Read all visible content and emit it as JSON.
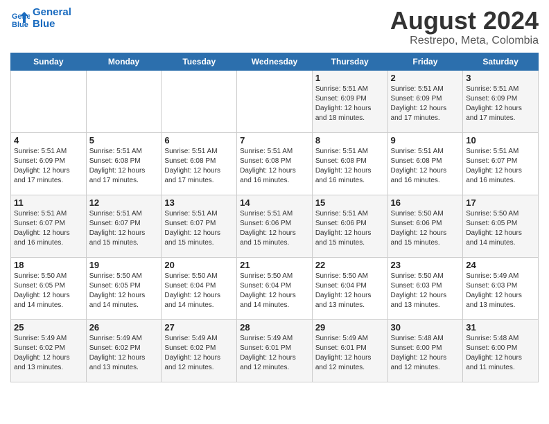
{
  "header": {
    "logo_line1": "General",
    "logo_line2": "Blue",
    "title": "August 2024",
    "subtitle": "Restrepo, Meta, Colombia"
  },
  "days_of_week": [
    "Sunday",
    "Monday",
    "Tuesday",
    "Wednesday",
    "Thursday",
    "Friday",
    "Saturday"
  ],
  "weeks": [
    [
      {
        "day": "",
        "info": ""
      },
      {
        "day": "",
        "info": ""
      },
      {
        "day": "",
        "info": ""
      },
      {
        "day": "",
        "info": ""
      },
      {
        "day": "1",
        "info": "Sunrise: 5:51 AM\nSunset: 6:09 PM\nDaylight: 12 hours\nand 18 minutes."
      },
      {
        "day": "2",
        "info": "Sunrise: 5:51 AM\nSunset: 6:09 PM\nDaylight: 12 hours\nand 17 minutes."
      },
      {
        "day": "3",
        "info": "Sunrise: 5:51 AM\nSunset: 6:09 PM\nDaylight: 12 hours\nand 17 minutes."
      }
    ],
    [
      {
        "day": "4",
        "info": "Sunrise: 5:51 AM\nSunset: 6:09 PM\nDaylight: 12 hours\nand 17 minutes."
      },
      {
        "day": "5",
        "info": "Sunrise: 5:51 AM\nSunset: 6:08 PM\nDaylight: 12 hours\nand 17 minutes."
      },
      {
        "day": "6",
        "info": "Sunrise: 5:51 AM\nSunset: 6:08 PM\nDaylight: 12 hours\nand 17 minutes."
      },
      {
        "day": "7",
        "info": "Sunrise: 5:51 AM\nSunset: 6:08 PM\nDaylight: 12 hours\nand 16 minutes."
      },
      {
        "day": "8",
        "info": "Sunrise: 5:51 AM\nSunset: 6:08 PM\nDaylight: 12 hours\nand 16 minutes."
      },
      {
        "day": "9",
        "info": "Sunrise: 5:51 AM\nSunset: 6:08 PM\nDaylight: 12 hours\nand 16 minutes."
      },
      {
        "day": "10",
        "info": "Sunrise: 5:51 AM\nSunset: 6:07 PM\nDaylight: 12 hours\nand 16 minutes."
      }
    ],
    [
      {
        "day": "11",
        "info": "Sunrise: 5:51 AM\nSunset: 6:07 PM\nDaylight: 12 hours\nand 16 minutes."
      },
      {
        "day": "12",
        "info": "Sunrise: 5:51 AM\nSunset: 6:07 PM\nDaylight: 12 hours\nand 15 minutes."
      },
      {
        "day": "13",
        "info": "Sunrise: 5:51 AM\nSunset: 6:07 PM\nDaylight: 12 hours\nand 15 minutes."
      },
      {
        "day": "14",
        "info": "Sunrise: 5:51 AM\nSunset: 6:06 PM\nDaylight: 12 hours\nand 15 minutes."
      },
      {
        "day": "15",
        "info": "Sunrise: 5:51 AM\nSunset: 6:06 PM\nDaylight: 12 hours\nand 15 minutes."
      },
      {
        "day": "16",
        "info": "Sunrise: 5:50 AM\nSunset: 6:06 PM\nDaylight: 12 hours\nand 15 minutes."
      },
      {
        "day": "17",
        "info": "Sunrise: 5:50 AM\nSunset: 6:05 PM\nDaylight: 12 hours\nand 14 minutes."
      }
    ],
    [
      {
        "day": "18",
        "info": "Sunrise: 5:50 AM\nSunset: 6:05 PM\nDaylight: 12 hours\nand 14 minutes."
      },
      {
        "day": "19",
        "info": "Sunrise: 5:50 AM\nSunset: 6:05 PM\nDaylight: 12 hours\nand 14 minutes."
      },
      {
        "day": "20",
        "info": "Sunrise: 5:50 AM\nSunset: 6:04 PM\nDaylight: 12 hours\nand 14 minutes."
      },
      {
        "day": "21",
        "info": "Sunrise: 5:50 AM\nSunset: 6:04 PM\nDaylight: 12 hours\nand 14 minutes."
      },
      {
        "day": "22",
        "info": "Sunrise: 5:50 AM\nSunset: 6:04 PM\nDaylight: 12 hours\nand 13 minutes."
      },
      {
        "day": "23",
        "info": "Sunrise: 5:50 AM\nSunset: 6:03 PM\nDaylight: 12 hours\nand 13 minutes."
      },
      {
        "day": "24",
        "info": "Sunrise: 5:49 AM\nSunset: 6:03 PM\nDaylight: 12 hours\nand 13 minutes."
      }
    ],
    [
      {
        "day": "25",
        "info": "Sunrise: 5:49 AM\nSunset: 6:02 PM\nDaylight: 12 hours\nand 13 minutes."
      },
      {
        "day": "26",
        "info": "Sunrise: 5:49 AM\nSunset: 6:02 PM\nDaylight: 12 hours\nand 13 minutes."
      },
      {
        "day": "27",
        "info": "Sunrise: 5:49 AM\nSunset: 6:02 PM\nDaylight: 12 hours\nand 12 minutes."
      },
      {
        "day": "28",
        "info": "Sunrise: 5:49 AM\nSunset: 6:01 PM\nDaylight: 12 hours\nand 12 minutes."
      },
      {
        "day": "29",
        "info": "Sunrise: 5:49 AM\nSunset: 6:01 PM\nDaylight: 12 hours\nand 12 minutes."
      },
      {
        "day": "30",
        "info": "Sunrise: 5:48 AM\nSunset: 6:00 PM\nDaylight: 12 hours\nand 12 minutes."
      },
      {
        "day": "31",
        "info": "Sunrise: 5:48 AM\nSunset: 6:00 PM\nDaylight: 12 hours\nand 11 minutes."
      }
    ]
  ]
}
